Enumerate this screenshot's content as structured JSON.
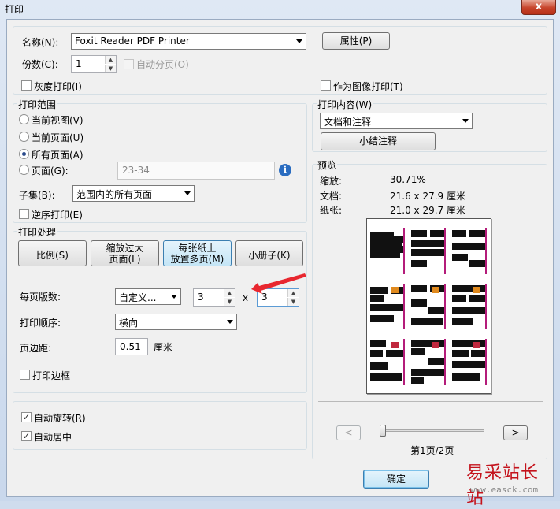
{
  "window": {
    "title": "打印",
    "close_glyph": "x"
  },
  "printer": {
    "name_label": "名称(N):",
    "name_value": "Foxit Reader PDF Printer",
    "properties_button": "属性(P)",
    "copies_label": "份数(C):",
    "copies_value": "1",
    "collate_label": "自动分页(O)",
    "grayscale_label": "灰度打印(I)",
    "print_as_image_label": "作为图像打印(T)"
  },
  "print_range": {
    "title": "打印范围",
    "options": [
      "当前视图(V)",
      "当前页面(U)",
      "所有页面(A)",
      "页面(G):"
    ],
    "selected_index": 2,
    "pages_value": "23-34",
    "subset_label": "子集(B):",
    "subset_value": "范围内的所有页面",
    "reverse_label": "逆序打印(E)"
  },
  "print_content": {
    "title": "打印内容(W)",
    "value": "文档和注释",
    "summarize_button": "小结注释"
  },
  "preview": {
    "title": "预览",
    "zoom_label": "缩放:",
    "zoom_value": "30.71%",
    "document_label": "文档:",
    "document_value": "21.6 x 27.9 厘米",
    "paper_label": "纸张:",
    "paper_value": "21.0 x 29.7 厘米",
    "prev_glyph": "<",
    "next_glyph": ">",
    "page_indicator": "第1页/2页"
  },
  "print_handling": {
    "title": "打印处理",
    "mode_buttons": [
      "比例(S)",
      "缩放过大页面(L)",
      "每张纸上放置多页(M)",
      "小册子(K)"
    ],
    "mode_button_lines": [
      [
        "比例(S)"
      ],
      [
        "缩放过大",
        "页面(L)"
      ],
      [
        "每张纸上",
        "放置多页(M)"
      ],
      [
        "小册子(K)"
      ]
    ],
    "pages_per_sheet_label": "每页版数:",
    "pages_per_sheet_value": "自定义...",
    "cols_value": "3",
    "times": "x",
    "rows_value": "3",
    "order_label": "打印顺序:",
    "order_value": "横向",
    "margin_label": "页边距:",
    "margin_value": "0.51",
    "margin_unit": "厘米",
    "border_label": "打印边框"
  },
  "options": {
    "auto_rotate_label": "自动旋转(R)",
    "auto_center_label": "自动居中"
  },
  "ok_button": "确定",
  "watermark": {
    "text": "易采站长站",
    "url": "www.easck.com"
  },
  "colors": {
    "accent": "#2a6cc0",
    "arrow": "#e8272f",
    "watermark": "#c4131c"
  }
}
